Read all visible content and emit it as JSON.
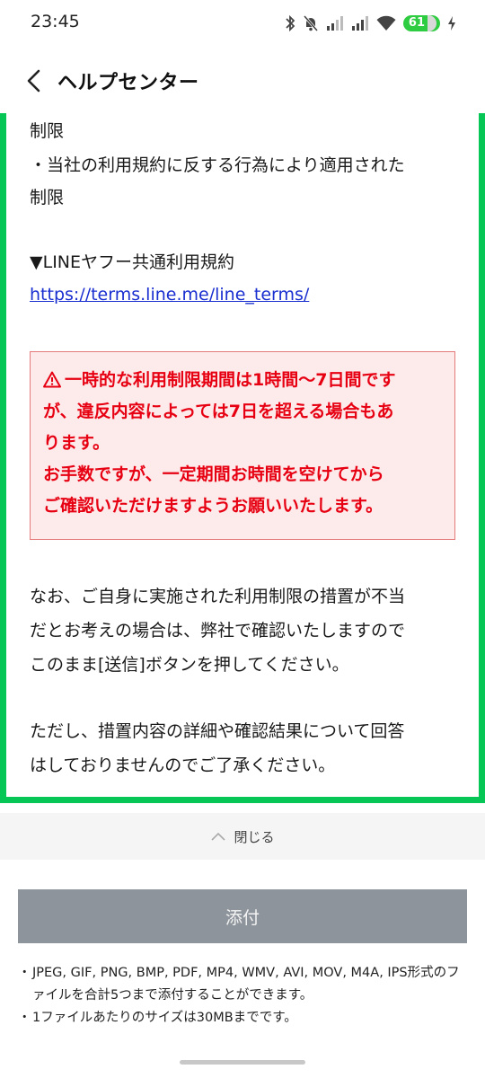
{
  "status_bar": {
    "time": "23:45",
    "battery": "61"
  },
  "header": {
    "title": "ヘルプセンター"
  },
  "content": {
    "line1": "制限",
    "line2": "・当社の利用規約に反する行為により適用された",
    "line3": "制限",
    "terms_heading": "▼LINEヤフー共通利用規約",
    "terms_link": "https://terms.line.me/line_terms/",
    "warning": {
      "line1": "一時的な利用制限期間は1時間〜7日間です",
      "line2": "が、違反内容によっては7日を超える場合もあ",
      "line3": "ります。",
      "line4": "お手数ですが、一定期間お時間を空けてから",
      "line5": "ご確認いただけますようお願いいたします。"
    },
    "para1_line1": "なお、ご自身に実施された利用制限の措置が不当",
    "para1_line2": "だとお考えの場合は、弊社で確認いたしますので",
    "para1_line3": "このまま[送信]ボタンを押してください。",
    "para2_line1": "ただし、措置内容の詳細や確認結果について回答",
    "para2_line2": "はしておりませんのでご了承ください。"
  },
  "close_bar": {
    "label": "閉じる"
  },
  "attach": {
    "label": "添付"
  },
  "notes": [
    "JPEG, GIF, PNG, BMP, PDF, MP4, WMV, AVI, MOV, M4A, IPS形式のファイルを合計5つまで添付することができます。",
    "1ファイルあたりのサイズは30MBまでです。"
  ],
  "colors": {
    "accent_green": "#06c755",
    "warning_red": "#e60012",
    "warning_bg": "#fdeaea",
    "link_blue": "#1a2fd0",
    "attach_button_bg": "#8e949b"
  }
}
